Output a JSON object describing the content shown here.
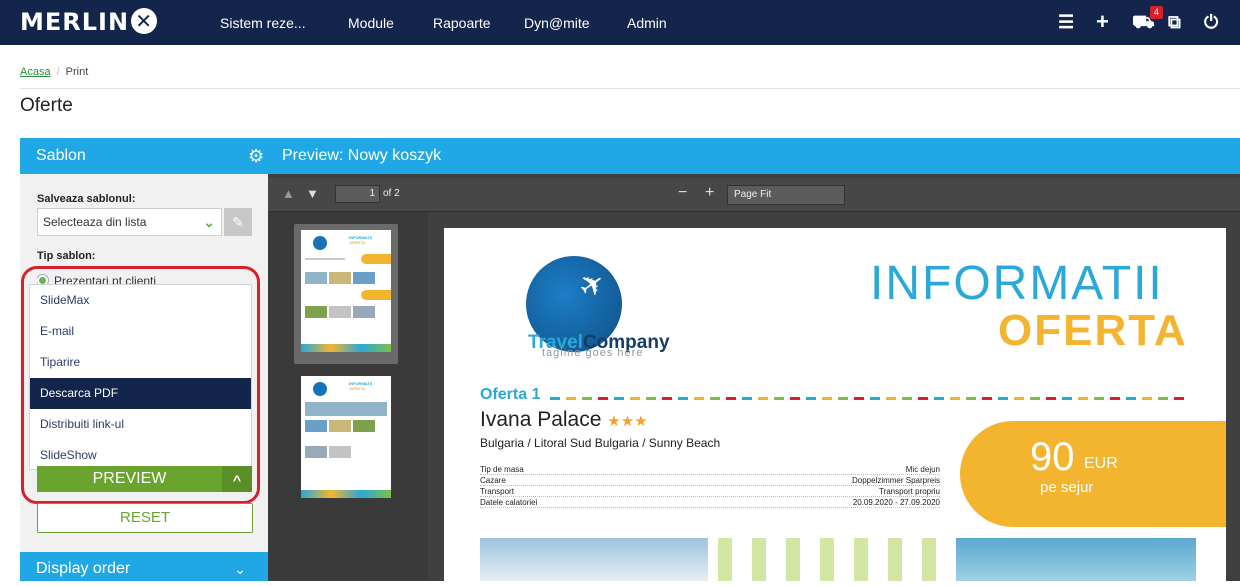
{
  "app": {
    "logo_text": "MERLIN",
    "nav": [
      "Sistem reze...",
      "Module",
      "Rapoarte",
      "Dyn@mite",
      "Admin"
    ],
    "cart_count": "4"
  },
  "breadcrumb": {
    "home": "Acasa",
    "current": "Print"
  },
  "page_title": "Oferte",
  "sidebar": {
    "panel_title": "Sablon",
    "save_label": "Salveaza sablonul:",
    "select_value": "Selecteaza din lista",
    "type_label": "Tip sablon:",
    "radio_label": "Prezentari pt clienti",
    "dropdown_items": [
      "SlideMax",
      "E-mail",
      "Tiparire",
      "Descarca PDF",
      "Distribuiti link-ul",
      "SlideShow"
    ],
    "selected_index": 3,
    "preview_label": "PREVIEW",
    "reset_label": "RESET",
    "display_order_label": "Display order"
  },
  "preview": {
    "title": "Preview: Nowy koszyk",
    "page_current": "1",
    "page_of": "of 2",
    "zoom": "Page Fit"
  },
  "document": {
    "brand_a": "Travel",
    "brand_b": "Company",
    "tagline": "tagline goes here",
    "heading_1": "INFORMATII",
    "heading_2": "OFERTA",
    "offer_label": "Oferta 1",
    "hotel_name": "Ivana Palace",
    "stars": "★★★",
    "location": "Bulgaria / Litoral Sud Bulgaria / Sunny Beach",
    "details": [
      {
        "label": "Tip de masa",
        "value": "Mic dejun"
      },
      {
        "label": "Cazare",
        "value": "Doppelzimmer Sparpreis"
      },
      {
        "label": "Transport",
        "value": "Transport propriu"
      },
      {
        "label": "Datele calatoriei",
        "value": "20.09.2020 - 27.09.2020"
      }
    ],
    "price": "90",
    "currency": "EUR",
    "price_note": "pe sejur"
  },
  "thumbs": {
    "title_a": "INFORMATII",
    "title_b": "OFERTA"
  },
  "colors": {
    "navy": "#13254a",
    "blue": "#20a8e6",
    "green": "#6aa42f",
    "orange": "#f3b530",
    "red": "#d8202a"
  },
  "icons": [
    "list-icon",
    "plus-icon",
    "cart-icon",
    "external-link-icon",
    "power-icon",
    "gear-icon",
    "edit-icon",
    "chevron-down-icon",
    "chevron-up-icon",
    "arrow-up-icon",
    "arrow-down-icon",
    "zoom-out-icon",
    "zoom-in-icon"
  ]
}
